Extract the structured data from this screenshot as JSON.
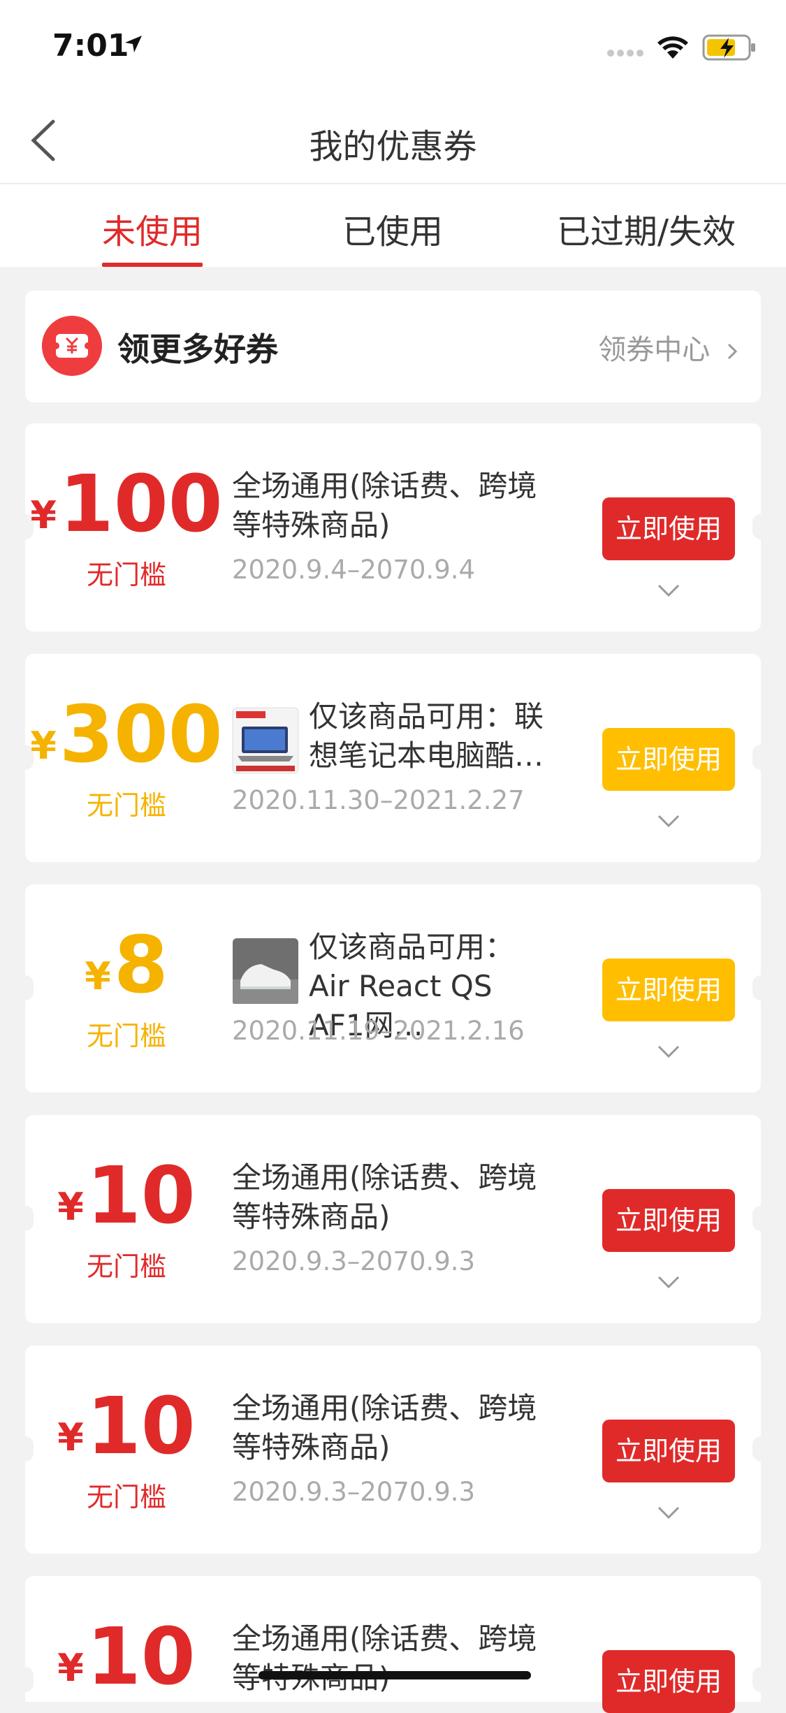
{
  "status_bar": {
    "time": "7:01"
  },
  "nav": {
    "title": "我的优惠券"
  },
  "tabs": [
    {
      "label": "未使用",
      "active": true
    },
    {
      "label": "已使用",
      "active": false
    },
    {
      "label": "已过期/失效",
      "active": false
    }
  ],
  "promo": {
    "label": "领更多好券",
    "link": "领券中心"
  },
  "coupons": [
    {
      "yen": "¥",
      "amount": "100",
      "condition": "无门槛",
      "color": "red",
      "desc": "全场通用(除话费、跨境等特殊商品)",
      "date": "2020.9.4–2070.9.4",
      "button": "立即使用",
      "has_thumb": false
    },
    {
      "yen": "¥",
      "amount": "300",
      "condition": "无门槛",
      "color": "yellow",
      "desc": "仅该商品可用：联想笔记本电脑酷…",
      "date": "2020.11.30–2021.2.27",
      "button": "立即使用",
      "has_thumb": true,
      "thumb_icon": "laptop-product-icon"
    },
    {
      "yen": "¥",
      "amount": "8",
      "condition": "无门槛",
      "color": "yellow",
      "desc": "仅该商品可用：Air React QS AF1网…",
      "date": "2020.11.19–2021.2.16",
      "button": "立即使用",
      "has_thumb": true,
      "thumb_icon": "sneaker-product-icon"
    },
    {
      "yen": "¥",
      "amount": "10",
      "condition": "无门槛",
      "color": "red",
      "desc": "全场通用(除话费、跨境等特殊商品)",
      "date": "2020.9.3–2070.9.3",
      "button": "立即使用",
      "has_thumb": false
    },
    {
      "yen": "¥",
      "amount": "10",
      "condition": "无门槛",
      "color": "red",
      "desc": "全场通用(除话费、跨境等特殊商品)",
      "date": "2020.9.3–2070.9.3",
      "button": "立即使用",
      "has_thumb": false
    },
    {
      "yen": "¥",
      "amount": "10",
      "condition": "",
      "color": "red",
      "desc": "全场通用(除话费、跨境等特殊商品)",
      "date": "",
      "button": "立即使用",
      "has_thumb": false
    }
  ],
  "colors": {
    "accent_red": "#e02a2a",
    "accent_yellow": "#ffbf00",
    "background": "#f2f2f2"
  }
}
